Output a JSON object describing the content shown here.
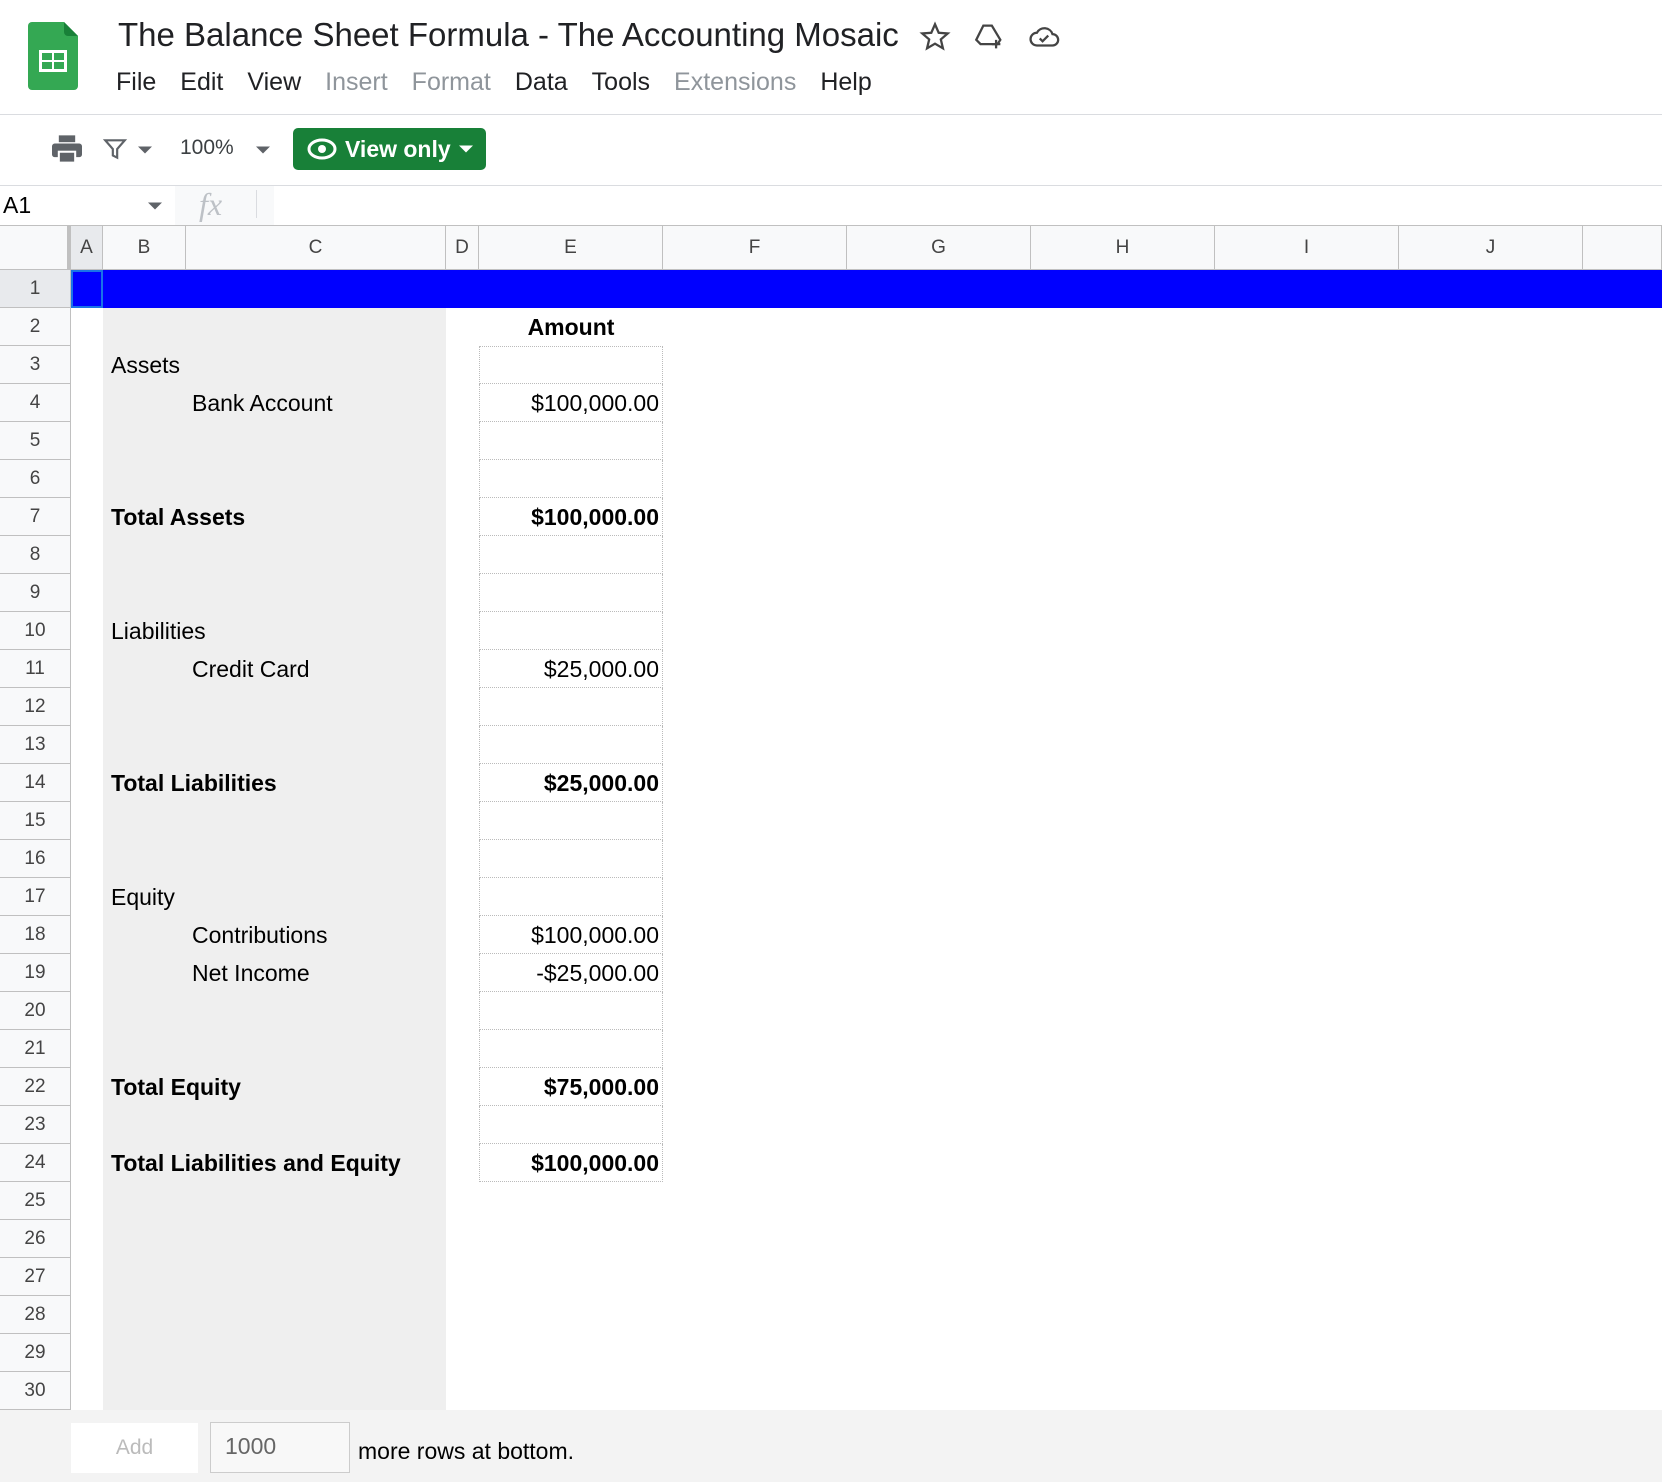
{
  "app": {
    "title": "The Balance Sheet Formula - The Accounting Mosaic",
    "icons": [
      "star-icon",
      "drive-add-icon",
      "cloud-saved-icon"
    ]
  },
  "menu": [
    {
      "label": "File",
      "enabled": true
    },
    {
      "label": "Edit",
      "enabled": true
    },
    {
      "label": "View",
      "enabled": true
    },
    {
      "label": "Insert",
      "enabled": false
    },
    {
      "label": "Format",
      "enabled": false
    },
    {
      "label": "Data",
      "enabled": true
    },
    {
      "label": "Tools",
      "enabled": true
    },
    {
      "label": "Extensions",
      "enabled": false
    },
    {
      "label": "Help",
      "enabled": true
    }
  ],
  "toolbar": {
    "zoom": "100%",
    "view_only": "View only",
    "accent": "#188038"
  },
  "formula_bar": {
    "name_box": "A1",
    "fx": "fx",
    "value": ""
  },
  "columns": [
    "A",
    "B",
    "C",
    "D",
    "E",
    "F",
    "G",
    "H",
    "I",
    "J"
  ],
  "rows": [
    "1",
    "2",
    "3",
    "4",
    "5",
    "6",
    "7",
    "8",
    "9",
    "10",
    "11",
    "12",
    "13",
    "14",
    "15",
    "16",
    "17",
    "18",
    "19",
    "20",
    "21",
    "22",
    "23",
    "24",
    "25",
    "26",
    "27",
    "28",
    "29",
    "30"
  ],
  "row1_fill": "#0000ff",
  "sheet": {
    "header_amount": "Amount",
    "lines": [
      {
        "row": 3,
        "label": "Assets",
        "indent": false,
        "bold": false,
        "amount": ""
      },
      {
        "row": 4,
        "label": "Bank Account",
        "indent": true,
        "bold": false,
        "amount": "$100,000.00"
      },
      {
        "row": 7,
        "label": "Total Assets",
        "indent": false,
        "bold": true,
        "amount": "$100,000.00"
      },
      {
        "row": 10,
        "label": "Liabilities",
        "indent": false,
        "bold": false,
        "amount": ""
      },
      {
        "row": 11,
        "label": "Credit Card",
        "indent": true,
        "bold": false,
        "amount": "$25,000.00"
      },
      {
        "row": 14,
        "label": "Total Liabilities",
        "indent": false,
        "bold": true,
        "amount": "$25,000.00"
      },
      {
        "row": 17,
        "label": "Equity",
        "indent": false,
        "bold": false,
        "amount": ""
      },
      {
        "row": 18,
        "label": "Contributions",
        "indent": true,
        "bold": false,
        "amount": "$100,000.00"
      },
      {
        "row": 19,
        "label": "Net Income",
        "indent": true,
        "bold": false,
        "amount": "-$25,000.00"
      },
      {
        "row": 22,
        "label": "Total Equity",
        "indent": false,
        "bold": true,
        "amount": "$75,000.00"
      },
      {
        "row": 24,
        "label": "Total Liabilities and Equity",
        "indent": false,
        "bold": true,
        "amount": "$100,000.00"
      }
    ]
  },
  "footer": {
    "add_label": "Add",
    "rows_value": "1000",
    "more_text": "more rows at bottom."
  }
}
